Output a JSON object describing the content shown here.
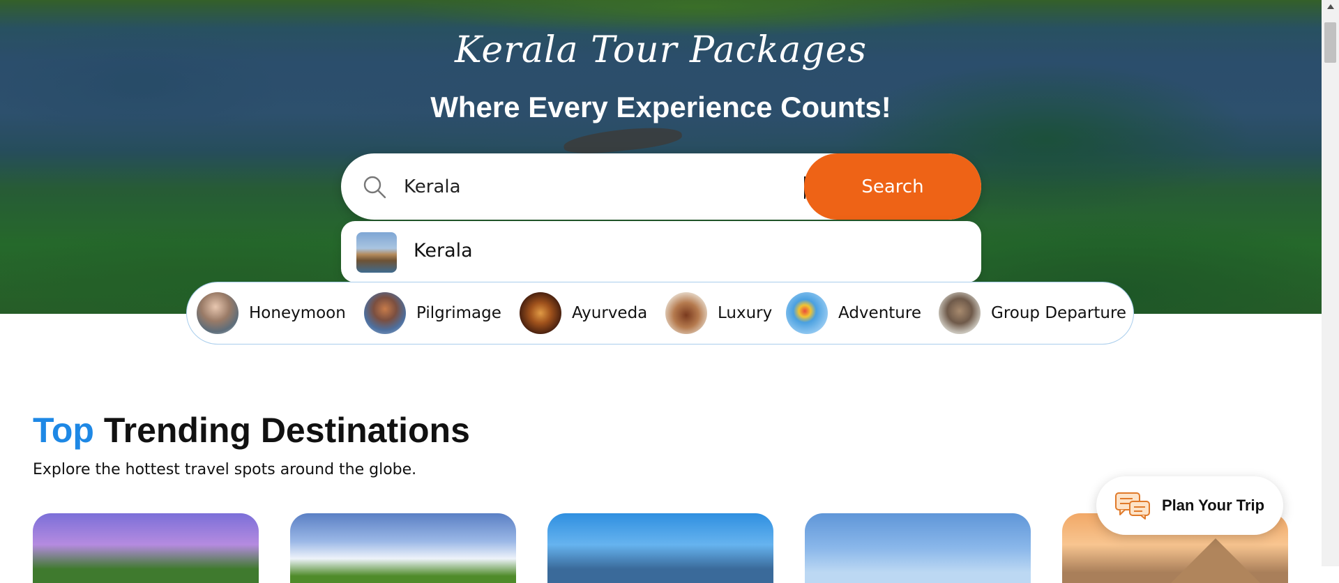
{
  "hero": {
    "script_title": "Kerala Tour Packages",
    "headline": "Where Every Experience Counts!"
  },
  "search": {
    "value": "Kerala",
    "button_label": "Search",
    "suggestion": {
      "label": "Kerala",
      "icon": "houseboat-thumbnail"
    }
  },
  "categories": [
    {
      "label": "Honeymoon",
      "icon": "couple-photo"
    },
    {
      "label": "Pilgrimage",
      "icon": "temple-photo"
    },
    {
      "label": "Ayurveda",
      "icon": "spa-photo"
    },
    {
      "label": "Luxury",
      "icon": "luxury-photo"
    },
    {
      "label": "Adventure",
      "icon": "hot-air-balloon-photo"
    },
    {
      "label": "Group Departure",
      "icon": "group-photo"
    }
  ],
  "section": {
    "title_accent": "Top",
    "title_rest": "Trending Destinations",
    "subtitle": "Explore the hottest travel spots around the globe."
  },
  "plan_trip": {
    "label": "Plan Your Trip",
    "icon": "chat-bubbles-icon"
  },
  "colors": {
    "accent_orange": "#ee6316",
    "accent_blue": "#1e88e5",
    "pill_border": "#a8cdec"
  }
}
